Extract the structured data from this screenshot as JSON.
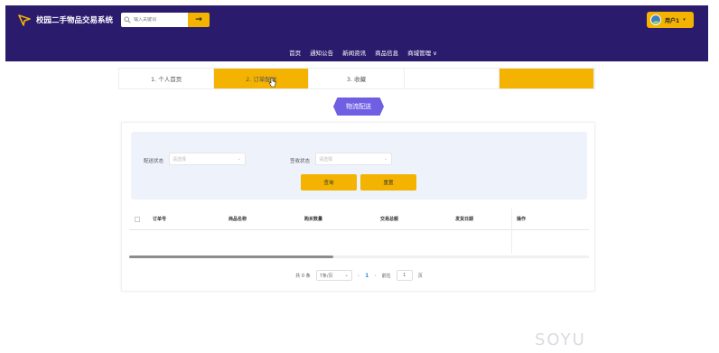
{
  "header": {
    "site_title": "校园二手物品交易系统",
    "search_placeholder": "输入关键词",
    "search_button": "→",
    "user_name": "用户1",
    "user_caret": "▾"
  },
  "nav": {
    "items": [
      "首页",
      "通知公告",
      "新闻资讯",
      "商品信息",
      "商城管理 ∨"
    ]
  },
  "tabs": [
    {
      "label": "1. 个人首页"
    },
    {
      "label": "2. 订单配送"
    },
    {
      "label": "3. 收藏"
    },
    {
      "label": ""
    },
    {
      "label": ""
    }
  ],
  "section": {
    "title": "物流配送"
  },
  "filters": {
    "delivery_label": "配送状态",
    "delivery_placeholder": "请选择",
    "receive_label": "签收状态",
    "receive_placeholder": "请选择",
    "query_button": "查询",
    "reset_button": "重置"
  },
  "table": {
    "columns": [
      "订单号",
      "商品名称",
      "购买数量",
      "交易总额",
      "发货日期",
      "操作"
    ]
  },
  "pagination": {
    "total": "共 0 条",
    "page_size": "7条/页",
    "prev": "‹",
    "current_page": "1",
    "next": "›",
    "goto_prefix": "前往",
    "goto_value": "1",
    "goto_suffix": "页"
  },
  "watermark": "SOYU",
  "colors": {
    "header_bg": "#2a1b6d",
    "accent": "#f3b300",
    "badge": "#6f5fe3",
    "filter_bg": "#eef2fb"
  }
}
